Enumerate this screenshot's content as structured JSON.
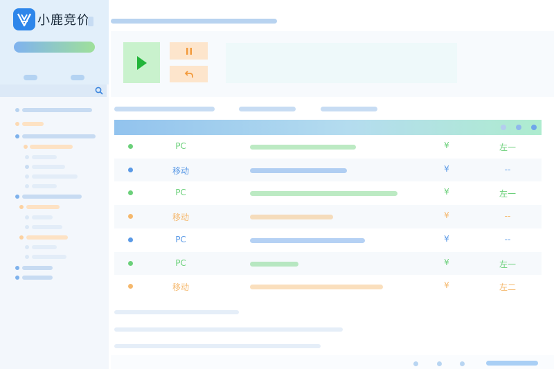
{
  "brand": {
    "name": "小鹿竞价",
    "accent": "#2e86ea"
  },
  "icons": {
    "logo": "deer-logo-icon",
    "search": "search-icon",
    "play": "play-icon",
    "pause": "pause-icon",
    "undo": "undo-icon"
  },
  "table": {
    "rows": [
      {
        "device": "PC",
        "currency": "¥",
        "position": "左一",
        "color": "#6bd07a",
        "fill": 0.59
      },
      {
        "device": "移动",
        "currency": "¥",
        "position": "--",
        "color": "#5b9ae6",
        "fill": 0.54
      },
      {
        "device": "PC",
        "currency": "¥",
        "position": "左一",
        "color": "#6bd07a",
        "fill": 0.82
      },
      {
        "device": "移动",
        "currency": "¥",
        "position": "--",
        "color": "#f5b86d",
        "fill": 0.46
      },
      {
        "device": "PC",
        "currency": "¥",
        "position": "--",
        "color": "#5b9ae6",
        "fill": 0.64
      },
      {
        "device": "PC",
        "currency": "¥",
        "position": "左一",
        "color": "#6bd07a",
        "fill": 0.27
      },
      {
        "device": "移动",
        "currency": "¥",
        "position": "左二",
        "color": "#f5b86d",
        "fill": 0.74
      }
    ]
  }
}
